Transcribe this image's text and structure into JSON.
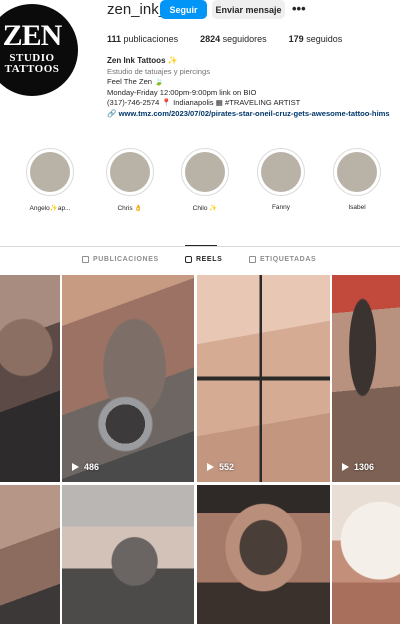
{
  "profile": {
    "username": "zen_ink_",
    "follow_label": "Seguir",
    "message_label": "Enviar mensaje",
    "more_label": "•••",
    "avatar_text_big": "ZEN",
    "avatar_text_small": "STUDIO",
    "avatar_text_small2": "TATTOOS"
  },
  "stats": {
    "posts_count": "111",
    "posts_label": "publicaciones",
    "followers_count": "2824",
    "followers_label": "seguidores",
    "following_count": "179",
    "following_label": "seguidos"
  },
  "bio": {
    "name": "Zen Ink Tattoos ✨",
    "category": "Estudio de tatuajes y piercings",
    "line1": "Feel The Zen 🍃",
    "line2": "Monday-Friday 12:00pm-9:00pm link on BIO",
    "line3_phone": "(317)-746-2574",
    "line3_location": "Indianapolis",
    "line3_tag": "#TRAVELING ARTIST",
    "link": "www.tmz.com/2023/07/02/pirates-star-oneil-cruz-gets-awesome-tattoo-hims"
  },
  "highlights": [
    {
      "label": "Angelo✨ap..."
    },
    {
      "label": "Chris 👌"
    },
    {
      "label": "Chilo ✨"
    },
    {
      "label": "Fanny"
    },
    {
      "label": "Isabel"
    }
  ],
  "tabs": [
    {
      "label": "PUBLICACIONES",
      "active": false
    },
    {
      "label": "REELS",
      "active": true
    },
    {
      "label": "ETIQUETADAS",
      "active": false
    }
  ],
  "reels": [
    {
      "views": ""
    },
    {
      "views": "486"
    },
    {
      "views": "552"
    },
    {
      "views": "1306"
    },
    {
      "views": ""
    },
    {
      "views": ""
    },
    {
      "views": ""
    },
    {
      "views": ""
    }
  ],
  "colors": {
    "accent": "#0095f6",
    "text": "#262626",
    "muted": "#737373",
    "link": "#00376b"
  }
}
